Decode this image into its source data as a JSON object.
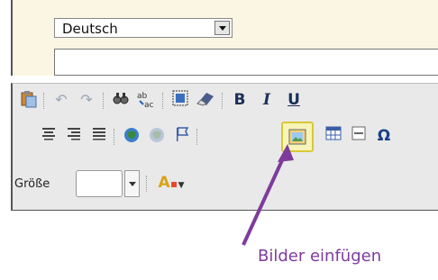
{
  "language_select": {
    "value": "Deutsch"
  },
  "toolbar": {
    "row1": {
      "icons": [
        "paste-icon",
        "undo-icon",
        "redo-icon",
        "find-icon",
        "replace-icon",
        "select-all-icon",
        "eraser-icon",
        "bold-icon",
        "italic-icon",
        "underline-icon"
      ],
      "bold_label": "B",
      "italic_label": "I",
      "underline_label": "U"
    },
    "row2": {
      "icons": [
        "align-center-icon",
        "align-right-icon",
        "justify-icon",
        "link-icon",
        "unlink-icon",
        "anchor-flag-icon",
        "insert-image-icon",
        "table-icon",
        "horizontal-rule-icon",
        "special-char-icon"
      ],
      "special_char_label": "Ω",
      "highlighted": "insert-image-icon"
    },
    "row3": {
      "size_label": "Größe",
      "size_value": "",
      "text_color_label": "A"
    }
  },
  "annotation": {
    "text": "Bilder einfügen",
    "color": "#7e3b9c"
  },
  "colors": {
    "toolbar_bg": "#e9e9e9",
    "top_bg": "#fbf5e3",
    "highlight": "#f6f4b8"
  }
}
